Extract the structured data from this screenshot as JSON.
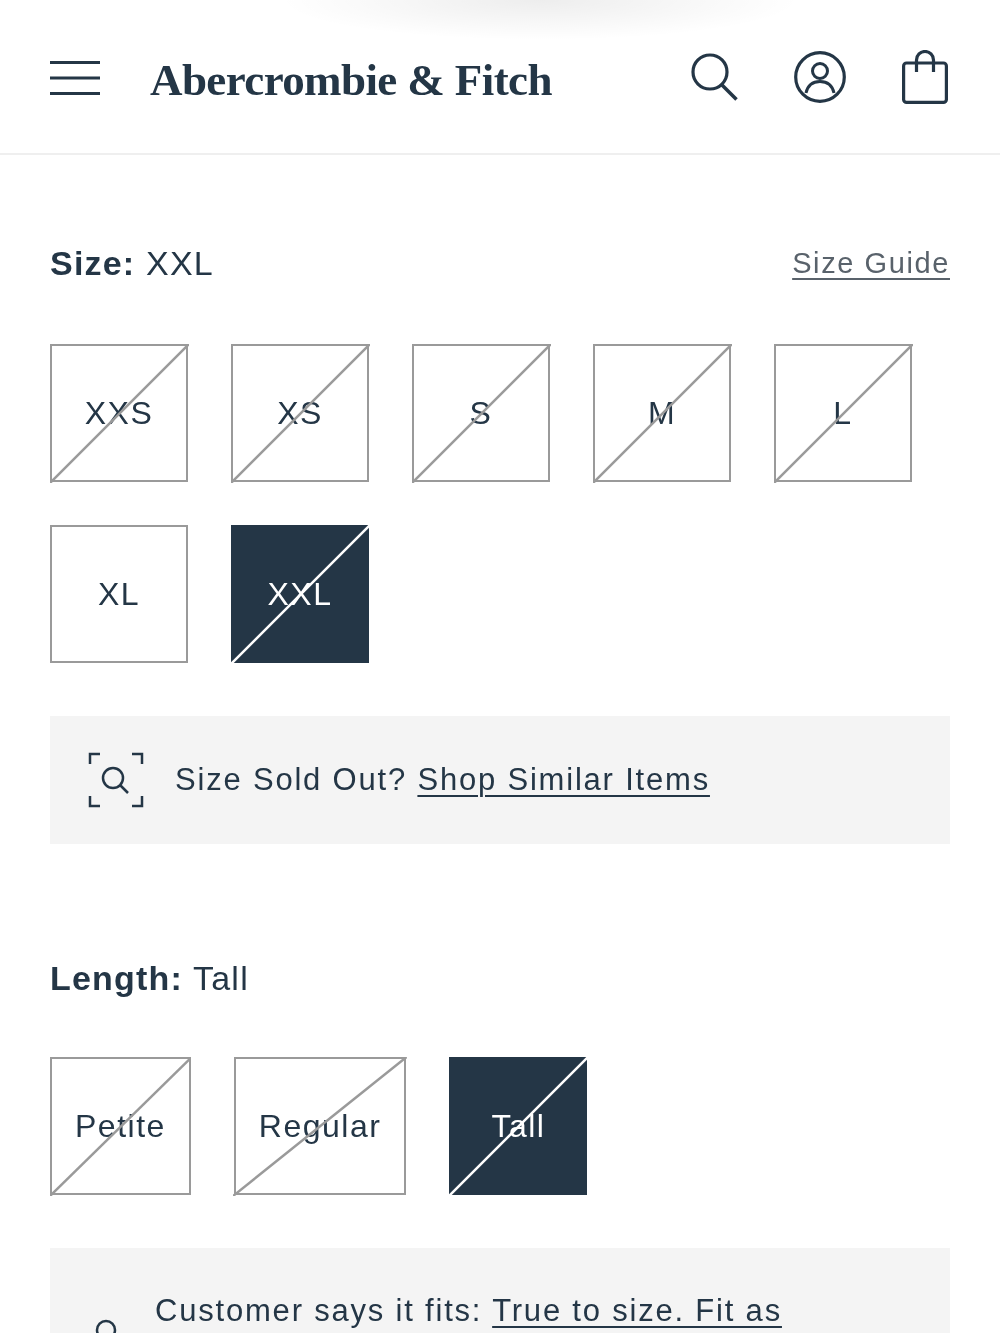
{
  "header": {
    "logo": "Abercrombie & Fitch"
  },
  "size": {
    "heading": "**Size:** XXL",
    "guide_link": "Size Guide",
    "options": [
      {
        "label": "XXS",
        "selected": false,
        "sold_out": true
      },
      {
        "label": "XS",
        "selected": false,
        "sold_out": true
      },
      {
        "label": "S",
        "selected": false,
        "sold_out": true
      },
      {
        "label": "M",
        "selected": false,
        "sold_out": true
      },
      {
        "label": "L",
        "selected": false,
        "sold_out": true
      },
      {
        "label": "XL",
        "selected": false,
        "sold_out": false
      },
      {
        "label": "XXL",
        "selected": true,
        "sold_out": true
      }
    ]
  },
  "sold_out_banner": {
    "text": "Size Sold Out?",
    "link": "Shop Similar Items"
  },
  "length": {
    "heading": "**Length:** Tall",
    "options": [
      {
        "label": "Petite",
        "selected": false,
        "sold_out": true
      },
      {
        "label": "Regular",
        "selected": false,
        "sold_out": true
      },
      {
        "label": "Tall",
        "selected": true,
        "sold_out": true
      }
    ]
  },
  "fit_banner": {
    "text": "Customer says it fits:",
    "link": "True to size. Fit as"
  }
}
